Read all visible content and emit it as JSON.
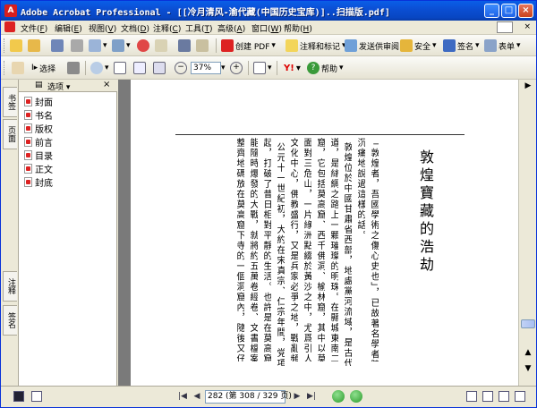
{
  "window": {
    "title": "Adobe Acrobat Professional - [[冷月清风-渝代藏(中国历史宝库)]..扫描版.pdf]",
    "buttons": [
      "_",
      "□",
      "×"
    ]
  },
  "menubar": {
    "items": [
      {
        "label": "文件",
        "hotkey": "F"
      },
      {
        "label": "编辑",
        "hotkey": "E"
      },
      {
        "label": "视图",
        "hotkey": "V"
      },
      {
        "label": "文档",
        "hotkey": "D"
      },
      {
        "label": "注释",
        "hotkey": "C"
      },
      {
        "label": "工具",
        "hotkey": "T"
      },
      {
        "label": "高级",
        "hotkey": "A"
      },
      {
        "label": "窗口",
        "hotkey": "W"
      },
      {
        "label": "帮助",
        "hotkey": "H"
      }
    ],
    "close": "×"
  },
  "toolbar1": {
    "create_pdf": "创建 PDF",
    "comment_markup": "注释和标记",
    "send_review": "发送供审阅",
    "security": "安全",
    "sign": "签名",
    "forms": "表单"
  },
  "toolbar2": {
    "select": "选择",
    "zoom": "37%",
    "help": "帮助"
  },
  "lefttabs": {
    "tab1": "书签",
    "tab2": "页面",
    "tab3": "注释",
    "tab4": "签名"
  },
  "bookmarks": {
    "options": "选项",
    "close": "×",
    "items": [
      "封面",
      "书名",
      "版权",
      "前言",
      "目录",
      "正文",
      "封底"
    ]
  },
  "document": {
    "title": "敦煌寶藏的浩劫",
    "columns": [
      "「敦煌者，吾國學術之傷心史也」，已故著名學者陳",
      "沉痛地說過這樣的話。",
      "敦煌位於中國甘肅省西部，地處黨河流域，是古代通",
      "道，是絲綢之路上一顆璀璨的明珠。在縣城東南二十五",
      "窟，它包括莫高窟、西千佛洞、榆林窟，其中以莫高窟",
      "面對三危山，一片綠洲點綴於黃沙之中，尤爲引人注目",
      "文化中心，佛教盛行，又是兵家必爭之地，戰亂頻仍。",
      "公元十一世紀初，大約在宋真宗、仁宗年間，党項羌",
      "起，打破了昔日相對平靜的生活。也許是在莫高窟寺院",
      "能隨時爆發的大戰，就將約五萬卷經卷、文書檔案、畫卷",
      "整齊地碼放在莫高窟下寺的一個洞窟內，隨後又仔細將"
    ]
  },
  "statusbar": {
    "page_display": "282 (第 308 / 329 页)"
  }
}
